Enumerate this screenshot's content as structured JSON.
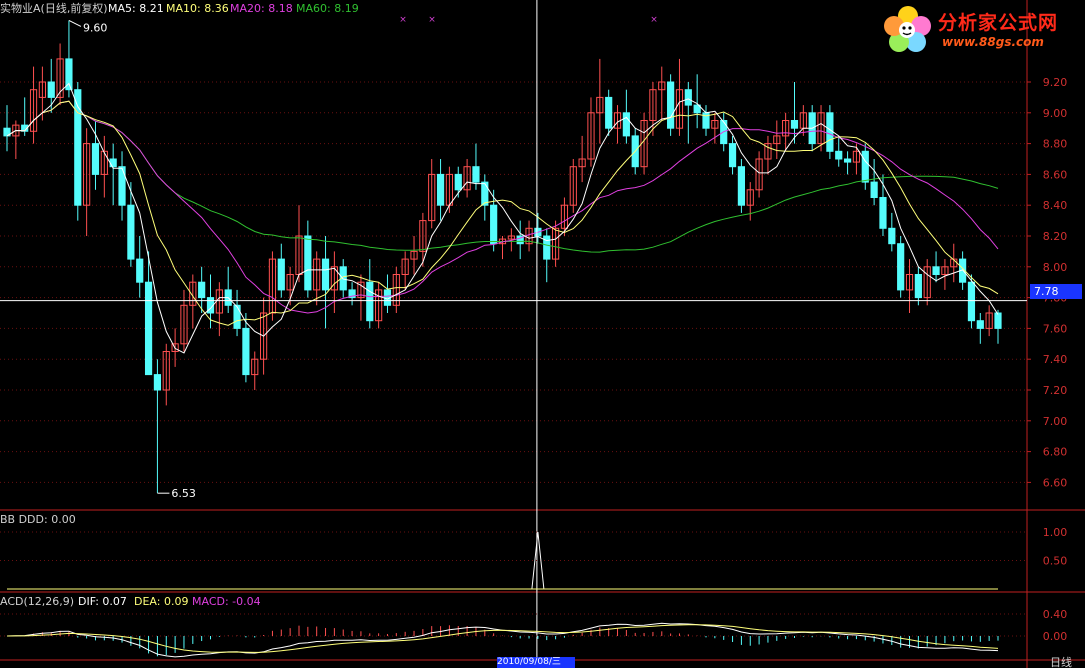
{
  "header": {
    "title": "实物业A(日线,前复权)",
    "ma5": "MA5: 8.21",
    "ma10": "MA10: 8.36",
    "ma20": "MA20: 8.18",
    "ma60": "MA60: 8.19"
  },
  "bb_panel": {
    "label": "BB  DDD: 0.00",
    "ticks": [
      "1.00",
      "0.50"
    ]
  },
  "macd_panel": {
    "label": "ACD(12,26,9)",
    "dif": "DIF: 0.07",
    "dea": "DEA: 0.09",
    "macd": "MACD: -0.04",
    "ticks": [
      "0.40",
      "0.00"
    ]
  },
  "crosshair": {
    "price": "7.78",
    "date": "2010/09/08/三"
  },
  "bottom_tab": "日线",
  "logo": {
    "text": "分析家公式网",
    "url": "www.88gs.com"
  },
  "colors": {
    "up": "#ff5050",
    "down": "#54fcfc",
    "ma5": "#ffffff",
    "ma10": "#ffff7a",
    "ma20": "#e040e0",
    "ma60": "#30c030",
    "axis": "#c02020",
    "crosshair": "#ffffff"
  },
  "chart_data": [
    {
      "type": "candlestick",
      "y_ticks": [
        "9.20",
        "9.00",
        "8.80",
        "8.60",
        "8.40",
        "8.20",
        "8.00",
        "7.80",
        "7.60",
        "7.40",
        "7.20",
        "7.00",
        "6.80",
        "6.60"
      ],
      "ylim": [
        6.5,
        9.4
      ],
      "annotations": {
        "high": "9.60",
        "low": "6.53"
      },
      "series": [
        {
          "name": "MA5"
        },
        {
          "name": "MA10"
        },
        {
          "name": "MA20"
        },
        {
          "name": "MA60"
        }
      ],
      "candles": [
        [
          8.9,
          9.05,
          8.75,
          8.85
        ],
        [
          8.85,
          8.95,
          8.7,
          8.92
        ],
        [
          8.92,
          9.1,
          8.85,
          8.88
        ],
        [
          8.88,
          9.3,
          8.8,
          9.15
        ],
        [
          9.1,
          9.3,
          8.95,
          9.2
        ],
        [
          9.2,
          9.35,
          9.0,
          9.1
        ],
        [
          9.1,
          9.45,
          9.05,
          9.35
        ],
        [
          9.35,
          9.6,
          9.1,
          9.15
        ],
        [
          9.15,
          9.2,
          8.3,
          8.4
        ],
        [
          8.4,
          8.9,
          8.2,
          8.8
        ],
        [
          8.8,
          8.95,
          8.5,
          8.6
        ],
        [
          8.6,
          8.85,
          8.45,
          8.75
        ],
        [
          8.7,
          8.8,
          8.4,
          8.65
        ],
        [
          8.65,
          8.75,
          8.3,
          8.4
        ],
        [
          8.4,
          8.55,
          8.0,
          8.05
        ],
        [
          8.05,
          8.2,
          7.8,
          7.9
        ],
        [
          7.9,
          8.1,
          7.3,
          7.3
        ],
        [
          7.3,
          7.4,
          6.53,
          7.2
        ],
        [
          7.2,
          7.5,
          7.1,
          7.45
        ],
        [
          7.45,
          7.6,
          7.35,
          7.5
        ],
        [
          7.5,
          7.85,
          7.45,
          7.75
        ],
        [
          7.75,
          7.95,
          7.6,
          7.9
        ],
        [
          7.9,
          8.0,
          7.7,
          7.8
        ],
        [
          7.8,
          7.95,
          7.6,
          7.7
        ],
        [
          7.7,
          7.9,
          7.55,
          7.85
        ],
        [
          7.85,
          8.0,
          7.7,
          7.75
        ],
        [
          7.75,
          7.85,
          7.55,
          7.6
        ],
        [
          7.6,
          7.7,
          7.25,
          7.3
        ],
        [
          7.3,
          7.45,
          7.2,
          7.4
        ],
        [
          7.4,
          7.8,
          7.3,
          7.7
        ],
        [
          7.7,
          8.1,
          7.65,
          8.05
        ],
        [
          8.05,
          8.15,
          7.8,
          7.85
        ],
        [
          7.85,
          8.0,
          7.75,
          7.95
        ],
        [
          7.95,
          8.4,
          7.9,
          8.2
        ],
        [
          8.2,
          8.3,
          7.8,
          7.85
        ],
        [
          7.85,
          8.1,
          7.75,
          8.05
        ],
        [
          8.05,
          8.2,
          7.6,
          7.85
        ],
        [
          7.85,
          8.1,
          7.7,
          8.0
        ],
        [
          8.0,
          8.05,
          7.8,
          7.85
        ],
        [
          7.85,
          7.9,
          7.75,
          7.8
        ],
        [
          7.8,
          7.95,
          7.65,
          7.9
        ],
        [
          7.9,
          8.05,
          7.6,
          7.65
        ],
        [
          7.65,
          7.9,
          7.6,
          7.85
        ],
        [
          7.85,
          7.95,
          7.7,
          7.75
        ],
        [
          7.75,
          8.0,
          7.7,
          7.95
        ],
        [
          7.95,
          8.1,
          7.85,
          8.05
        ],
        [
          8.05,
          8.2,
          7.95,
          8.1
        ],
        [
          8.1,
          8.35,
          8.0,
          8.3
        ],
        [
          8.3,
          8.7,
          8.25,
          8.6
        ],
        [
          8.6,
          8.7,
          8.3,
          8.4
        ],
        [
          8.4,
          8.65,
          8.35,
          8.6
        ],
        [
          8.6,
          8.65,
          8.45,
          8.5
        ],
        [
          8.5,
          8.7,
          8.45,
          8.65
        ],
        [
          8.65,
          8.8,
          8.5,
          8.55
        ],
        [
          8.55,
          8.6,
          8.3,
          8.4
        ],
        [
          8.4,
          8.5,
          8.1,
          8.15
        ],
        [
          8.15,
          8.2,
          8.05,
          8.18
        ],
        [
          8.18,
          8.25,
          8.1,
          8.2
        ],
        [
          8.2,
          8.3,
          8.05,
          8.15
        ],
        [
          8.15,
          8.3,
          8.1,
          8.25
        ],
        [
          8.25,
          8.35,
          8.15,
          8.2
        ],
        [
          8.2,
          8.25,
          7.9,
          8.05
        ],
        [
          8.05,
          8.3,
          8.0,
          8.25
        ],
        [
          8.25,
          8.45,
          8.2,
          8.4
        ],
        [
          8.4,
          8.7,
          8.35,
          8.65
        ],
        [
          8.65,
          8.85,
          8.55,
          8.7
        ],
        [
          8.7,
          9.1,
          8.65,
          9.0
        ],
        [
          9.0,
          9.35,
          8.8,
          9.1
        ],
        [
          9.1,
          9.15,
          8.85,
          8.9
        ],
        [
          8.9,
          9.05,
          8.8,
          9.0
        ],
        [
          9.0,
          9.15,
          8.8,
          8.85
        ],
        [
          8.85,
          8.9,
          8.6,
          8.65
        ],
        [
          8.65,
          9.0,
          8.6,
          8.95
        ],
        [
          8.95,
          9.2,
          8.85,
          9.15
        ],
        [
          9.15,
          9.3,
          8.95,
          9.2
        ],
        [
          9.2,
          9.25,
          8.85,
          8.9
        ],
        [
          8.9,
          9.35,
          8.85,
          9.15
        ],
        [
          9.15,
          9.2,
          8.8,
          9.05
        ],
        [
          9.05,
          9.25,
          8.9,
          9.0
        ],
        [
          9.0,
          9.05,
          8.85,
          8.9
        ],
        [
          8.9,
          9.0,
          8.8,
          8.95
        ],
        [
          8.95,
          9.0,
          8.75,
          8.8
        ],
        [
          8.8,
          8.85,
          8.6,
          8.65
        ],
        [
          8.65,
          8.7,
          8.35,
          8.4
        ],
        [
          8.4,
          8.55,
          8.3,
          8.5
        ],
        [
          8.5,
          8.75,
          8.45,
          8.7
        ],
        [
          8.7,
          8.85,
          8.6,
          8.8
        ],
        [
          8.8,
          8.95,
          8.7,
          8.85
        ],
        [
          8.85,
          9.0,
          8.75,
          8.95
        ],
        [
          8.95,
          9.2,
          8.8,
          8.9
        ],
        [
          8.9,
          9.05,
          8.85,
          9.0
        ],
        [
          9.0,
          9.05,
          8.75,
          8.8
        ],
        [
          8.8,
          9.05,
          8.75,
          9.0
        ],
        [
          9.0,
          9.05,
          8.7,
          8.75
        ],
        [
          8.75,
          8.85,
          8.65,
          8.7
        ],
        [
          8.7,
          8.75,
          8.6,
          8.68
        ],
        [
          8.68,
          8.8,
          8.6,
          8.75
        ],
        [
          8.75,
          8.8,
          8.5,
          8.55
        ],
        [
          8.55,
          8.7,
          8.4,
          8.45
        ],
        [
          8.45,
          8.6,
          8.2,
          8.25
        ],
        [
          8.25,
          8.35,
          8.1,
          8.15
        ],
        [
          8.15,
          8.2,
          7.8,
          7.85
        ],
        [
          7.85,
          8.05,
          7.7,
          7.95
        ],
        [
          7.95,
          8.0,
          7.75,
          7.8
        ],
        [
          7.8,
          8.05,
          7.75,
          8.0
        ],
        [
          8.0,
          8.1,
          7.9,
          7.95
        ],
        [
          7.95,
          8.05,
          7.85,
          8.0
        ],
        [
          8.0,
          8.15,
          7.9,
          8.05
        ],
        [
          8.05,
          8.1,
          7.85,
          7.9
        ],
        [
          7.9,
          7.95,
          7.6,
          7.65
        ],
        [
          7.65,
          7.7,
          7.5,
          7.6
        ],
        [
          7.6,
          7.75,
          7.55,
          7.7
        ],
        [
          7.7,
          7.72,
          7.5,
          7.6
        ]
      ]
    },
    {
      "type": "line",
      "name": "DDD",
      "ylim": [
        0,
        1.1
      ],
      "spike_index": 60,
      "spike_value": 1.0
    },
    {
      "type": "bar",
      "name": "MACD",
      "ylim": [
        -0.25,
        0.45
      ],
      "series": [
        {
          "name": "DIF"
        },
        {
          "name": "DEA"
        },
        {
          "name": "MACD"
        }
      ]
    }
  ]
}
